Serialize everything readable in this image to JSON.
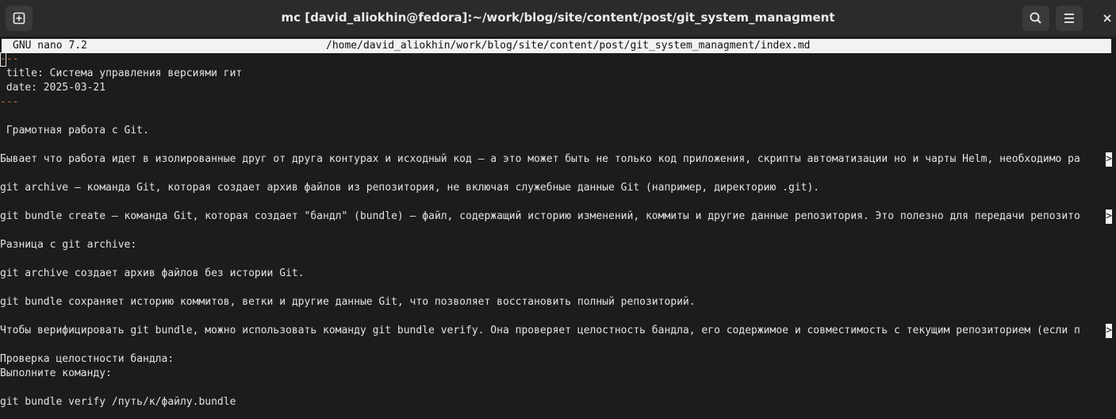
{
  "window": {
    "title": "mc [david_aliokhin@fedora]:~/work/blog/site/content/post/git_system_managment"
  },
  "nano": {
    "version": "GNU nano 7.2",
    "file_path": "/home/david_aliokhin/work/blog/site/content/post/git_system_managment/index.md"
  },
  "editor": {
    "frontmatter_open": "---",
    "frontmatter_close": "---",
    "truncation_marker": ">",
    "lines": [
      " title: Система управления версиями гит",
      " date: 2025-03-21",
      " Грамотная работа с Git.",
      "Бывает что работа идет в изолированные друг от друга контурах и исходный код — а это может быть не только код приложения, скрипты автоматизации но и чарты Helm, необходимо ра",
      "git archive — команда Git, которая создает архив файлов из репозитория, не включая служебные данные Git (например, директорию .git).",
      "git bundle create — команда Git, которая создает \"бандл\" (bundle) — файл, содержащий историю изменений, коммиты и другие данные репозитория. Это полезно для передачи репозито",
      "Разница с git archive:",
      "git archive создает архив файлов без истории Git.",
      "git bundle сохраняет историю коммитов, ветки и другие данные Git, что позволяет восстановить полный репозиторий.",
      "Чтобы верифицировать git bundle, можно использовать команду git bundle verify. Она проверяет целостность бандла, его содержимое и совместимость с текущим репозиторием (если п",
      "Проверка целостности бандла:",
      "Выполните команду:",
      "git bundle verify /путь/к/файлу.bundle"
    ]
  }
}
